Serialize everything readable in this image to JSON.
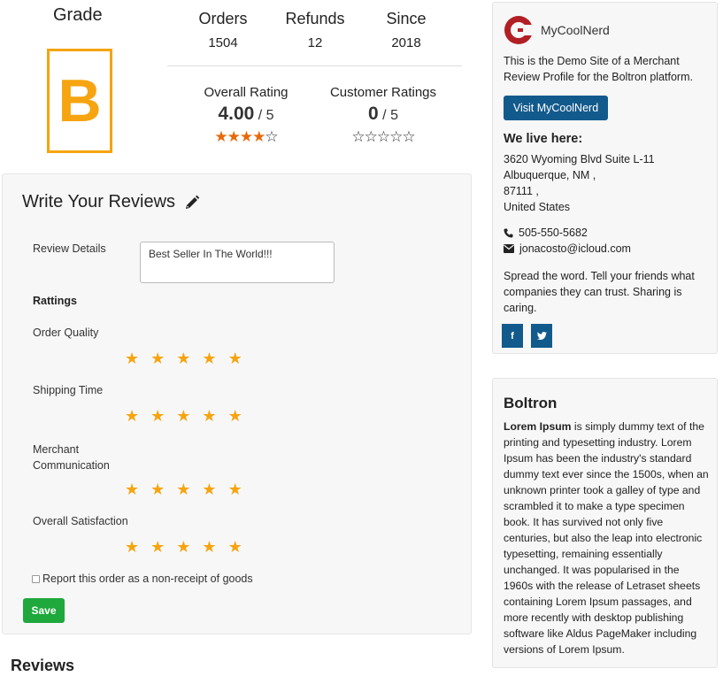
{
  "grade": {
    "title": "Grade",
    "letter": "B"
  },
  "stats": [
    {
      "label": "Orders",
      "value": "1504"
    },
    {
      "label": "Refunds",
      "value": "12"
    },
    {
      "label": "Since",
      "value": "2018"
    }
  ],
  "overall_rating": {
    "label": "Overall Rating",
    "score": "4.00",
    "out_of": "/ 5",
    "stars_filled": 4,
    "stars_total": 5
  },
  "customer_rating": {
    "label": "Customer Ratings",
    "score": "0",
    "out_of": "/ 5",
    "stars_filled": 0,
    "stars_total": 5
  },
  "review_form": {
    "title": "Write Your Reviews",
    "details_label": "Review Details",
    "details_value": "Best Seller In The World!!!",
    "ratings_heading": "Rattings",
    "criteria": [
      {
        "label": "Order Quality",
        "stars": 5
      },
      {
        "label": "Shipping Time",
        "stars": 5
      },
      {
        "label": "Merchant Communication",
        "stars": 5
      },
      {
        "label": "Overall Satisfaction",
        "stars": 5
      }
    ],
    "checkbox_label": "Report this order as a non-receipt of goods",
    "save_label": "Save"
  },
  "reviews_title": "Reviews",
  "merchant_card": {
    "name": "MyCoolNerd",
    "description": "This is the Demo Site of a Merchant Review Profile for the Boltron platform.",
    "visit_label": "Visit MyCoolNerd",
    "live_heading": "We live here:",
    "address_lines": [
      "3620 Wyoming Blvd Suite L-11",
      "Albuquerque, NM ,",
      "87111 ,",
      "United States"
    ],
    "phone": "505-550-5682",
    "email": "jonacosto@icloud.com",
    "share_text": "Spread the word. Tell your friends what companies they can trust. Sharing is caring.",
    "social": [
      "f",
      "t"
    ],
    "brand_color": "#b11f24",
    "button_color": "#135a8c"
  },
  "about_card": {
    "title": "Boltron",
    "lead": "Lorem Ipsum",
    "body": " is simply dummy text of the printing and typesetting industry. Lorem Ipsum has been the industry's standard dummy text ever since the 1500s, when an unknown printer took a galley of type and scrambled it to make a type specimen book. It has survived not only five centuries, but also the leap into electronic typesetting, remaining essentially unchanged. It was popularised in the 1960s with the release of Letraset sheets containing Lorem Ipsum passages, and more recently with desktop publishing software like Aldus PageMaker including versions of Lorem Ipsum."
  },
  "colors": {
    "grade": "#f6a410",
    "star_filled": "#e8690b",
    "rating_star": "#f6a410",
    "save": "#1fa83c"
  }
}
